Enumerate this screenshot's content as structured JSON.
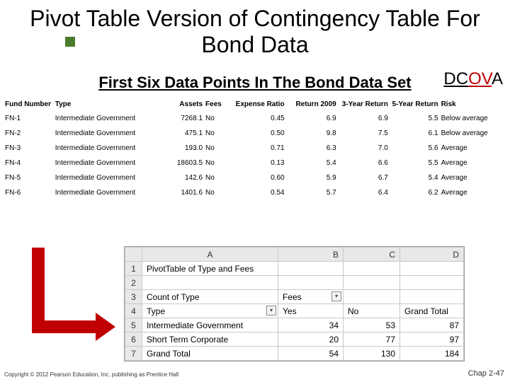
{
  "title": "Pivot Table Version of Contingency Table For Bond Data",
  "dcova": {
    "d": "D",
    "c": "C",
    "o": "O",
    "v": "V",
    "a": "A"
  },
  "subtitle": "First Six Data Points In The Bond Data Set",
  "headers": {
    "fund": "Fund Number",
    "type": "Type",
    "assets": "Assets",
    "fees": "Fees",
    "expense": "Expense Ratio",
    "ret2009": "Return 2009",
    "ret3": "3-Year Return",
    "ret5": "5-Year Return",
    "risk": "Risk"
  },
  "rows": [
    {
      "fund": "FN-1",
      "type": "Intermediate Government",
      "assets": "7268.1",
      "fees": "No",
      "exp": "0.45",
      "r09": "6.9",
      "r3": "6.9",
      "r5": "5.5",
      "risk": "Below average"
    },
    {
      "fund": "FN-2",
      "type": "Intermediate Government",
      "assets": "475.1",
      "fees": "No",
      "exp": "0.50",
      "r09": "9.8",
      "r3": "7.5",
      "r5": "6.1",
      "risk": "Below average"
    },
    {
      "fund": "FN-3",
      "type": "Intermediate Government",
      "assets": "193.0",
      "fees": "No",
      "exp": "0.71",
      "r09": "6.3",
      "r3": "7.0",
      "r5": "5.6",
      "risk": "Average"
    },
    {
      "fund": "FN-4",
      "type": "Intermediate Government",
      "assets": "18603.5",
      "fees": "No",
      "exp": "0.13",
      "r09": "5.4",
      "r3": "6.6",
      "r5": "5.5",
      "risk": "Average"
    },
    {
      "fund": "FN-5",
      "type": "Intermediate Government",
      "assets": "142.6",
      "fees": "No",
      "exp": "0.60",
      "r09": "5.9",
      "r3": "6.7",
      "r5": "5.4",
      "risk": "Average"
    },
    {
      "fund": "FN-6",
      "type": "Intermediate Government",
      "assets": "1401.6",
      "fees": "No",
      "exp": "0.54",
      "r09": "5.7",
      "r3": "6.4",
      "r5": "6.2",
      "risk": "Average"
    }
  ],
  "pivot": {
    "colA": "A",
    "colB": "B",
    "colC": "C",
    "colD": "D",
    "r1a": "PivotTable of Type and Fees",
    "r3a": "Count of Type",
    "r3b": "Fees",
    "r4a": "Type",
    "r4b": "Yes",
    "r4c": "No",
    "r4d": "Grand Total",
    "r5a": "Intermediate Government",
    "r5b": "34",
    "r5c": "53",
    "r5d": "87",
    "r6a": "Short Term Corporate",
    "r6b": "20",
    "r6c": "77",
    "r6d": "97",
    "r7a": "Grand Total",
    "r7b": "54",
    "r7c": "130",
    "r7d": "184",
    "dd": "▾"
  },
  "footer_left": "Copyright © 2012 Pearson Education, Inc. publishing as Prentice Hall",
  "footer_right": "Chap 2-47"
}
